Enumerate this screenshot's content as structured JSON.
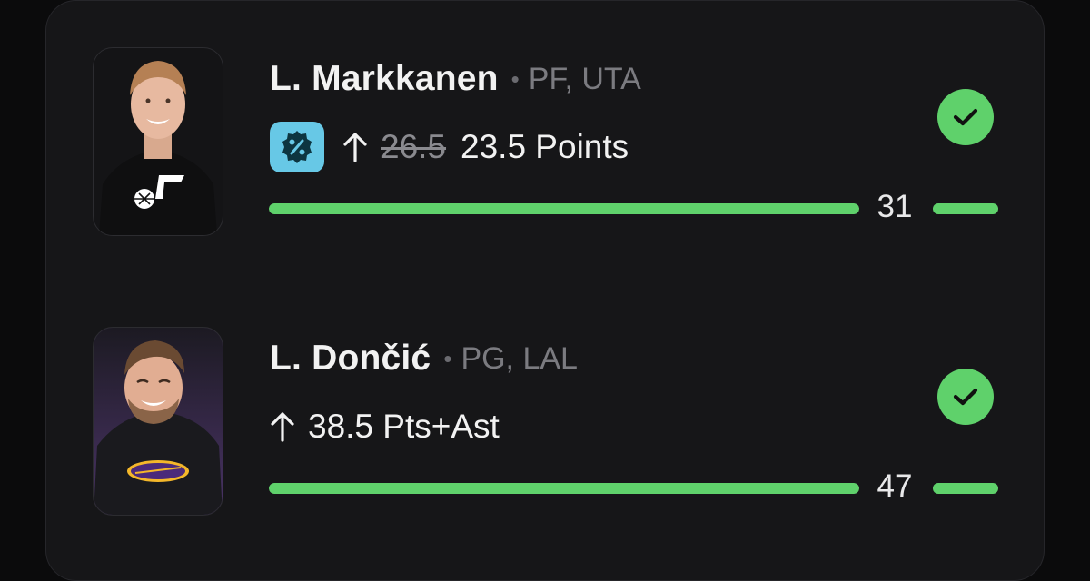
{
  "picks": [
    {
      "player_name": "L. Markkanen",
      "separator": "•",
      "position_team": "PF, UTA",
      "team_logo_icon": "jazz-note-icon",
      "discount_icon": "percent-badge-icon",
      "direction_icon": "arrow-up-icon",
      "original_line": "26.5",
      "prop_line": "23.5 Points",
      "actual_value": "31",
      "progress_fraction": 1.0,
      "status": "hit",
      "status_icon": "check-icon",
      "colors": {
        "accent": "#5fd16b",
        "badge": "#67c8e6",
        "avatar_bg": "#141416"
      }
    },
    {
      "player_name": "L. Dončić",
      "separator": "•",
      "position_team": "PG, LAL",
      "team_logo_icon": "lakers-logo-icon",
      "direction_icon": "arrow-up-icon",
      "prop_line": "38.5 Pts+Ast",
      "actual_value": "47",
      "progress_fraction": 1.0,
      "status": "hit",
      "status_icon": "check-icon",
      "colors": {
        "accent": "#5fd16b",
        "avatar_bg": "#3a2a52"
      }
    }
  ]
}
